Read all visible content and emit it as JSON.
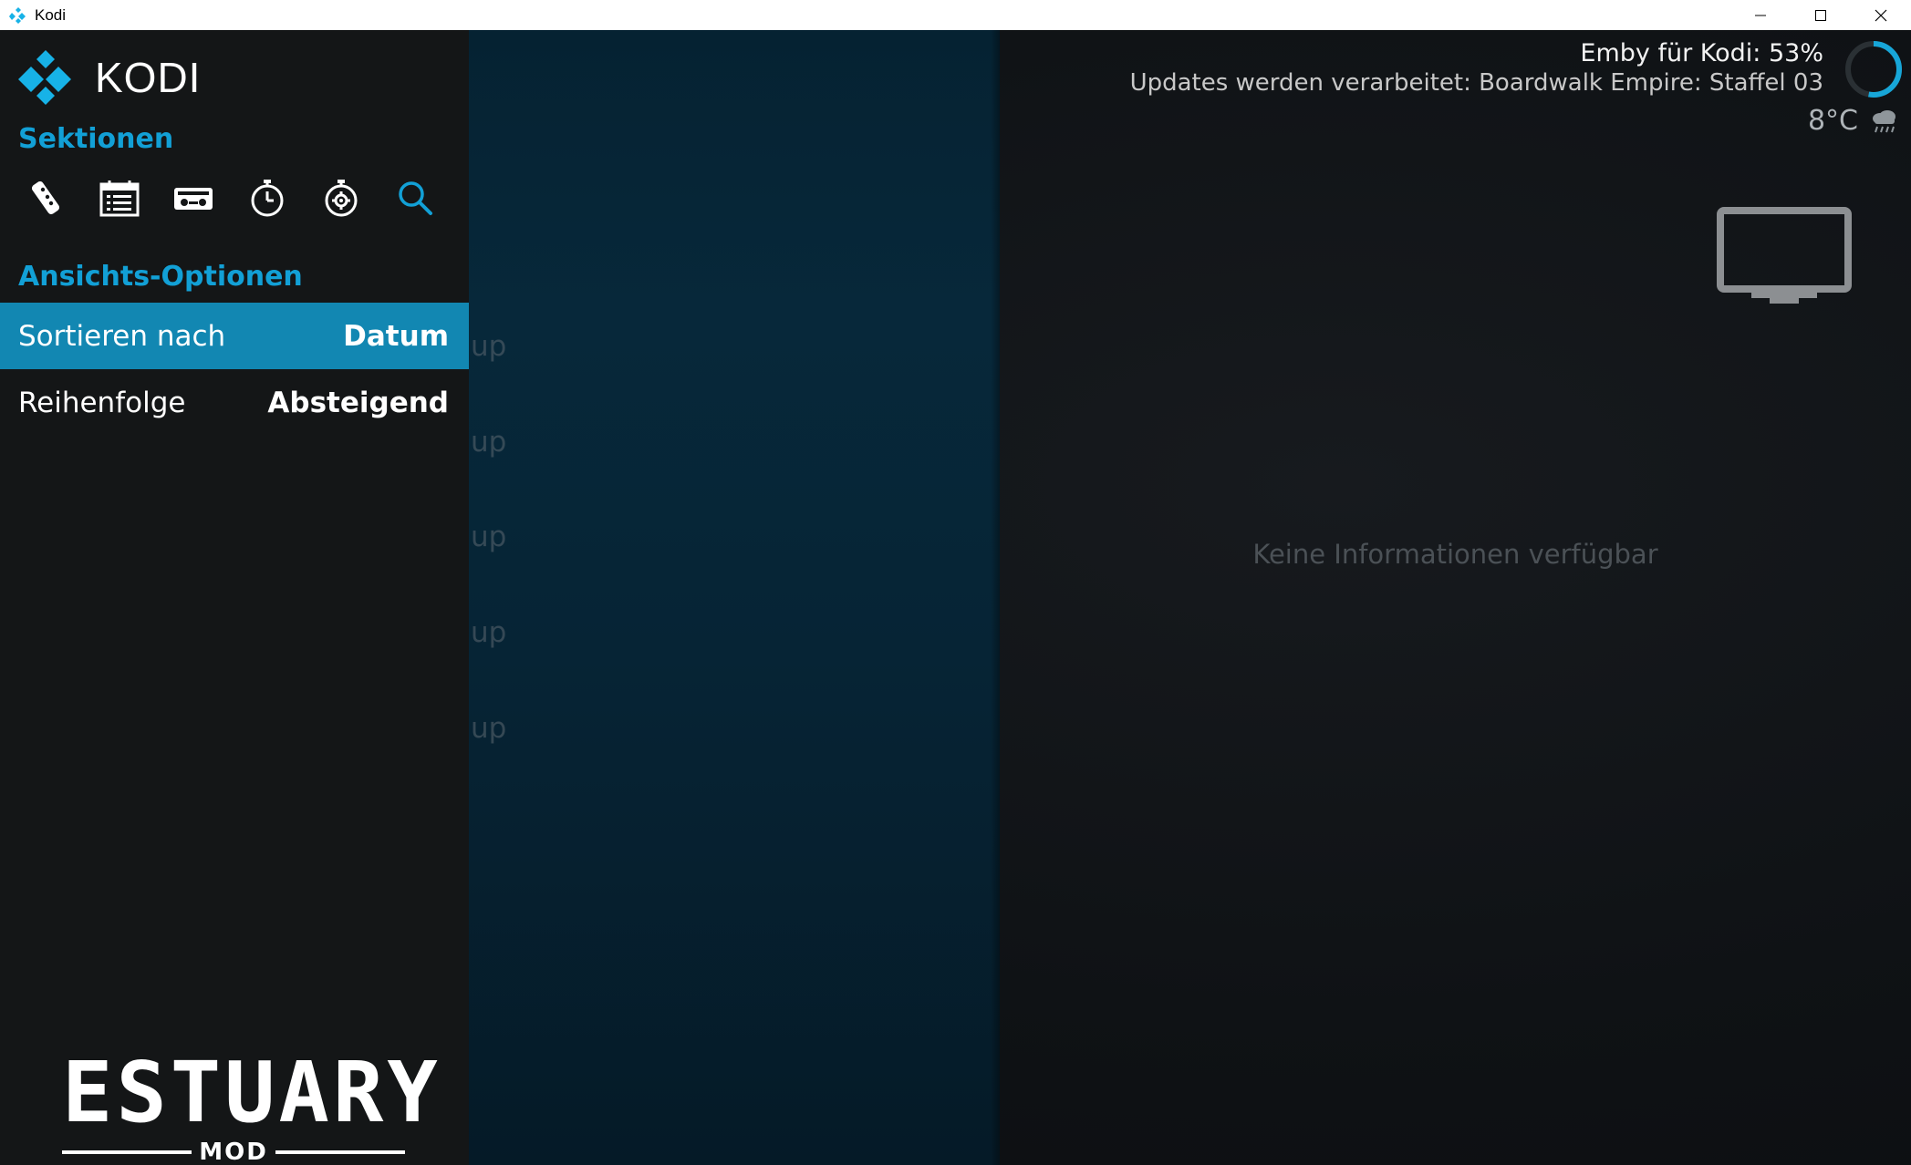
{
  "window": {
    "title": "Kodi"
  },
  "header": {
    "logo_text": "KODI",
    "sections_label": "Sektionen",
    "view_options_label": "Ansichts-Optionen"
  },
  "section_icons": [
    "remote-icon",
    "calendar-icon",
    "recordings-icon",
    "timer-icon",
    "timer-settings-icon",
    "search-icon"
  ],
  "options": [
    {
      "label": "Sortieren nach",
      "value": "Datum"
    },
    {
      "label": "Reihenfolge",
      "value": "Absteigend"
    }
  ],
  "background_items": [
    "up",
    "up",
    "up",
    "up",
    "up"
  ],
  "status": {
    "progress_text": "Emby für Kodi: 53%",
    "progress_percent": 53,
    "update_text": "Updates werden verarbeitet: Boardwalk Empire: Staffel 03"
  },
  "weather": {
    "temperature": "8°C",
    "icon": "rain-cloud-icon"
  },
  "info": {
    "empty_text": "Keine Informationen verfügbar"
  },
  "brand": {
    "name": "ESTUARY",
    "sub": "MOD"
  },
  "colors": {
    "accent": "#12a0d6",
    "selected_row": "#1287b2"
  }
}
